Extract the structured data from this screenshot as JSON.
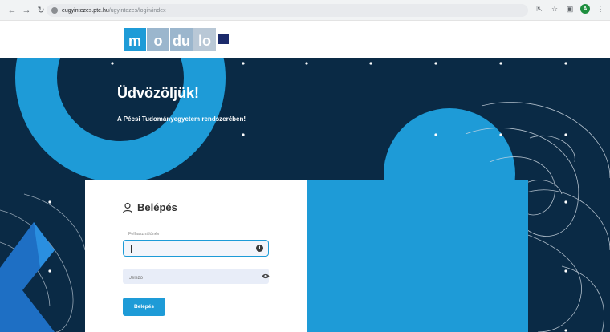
{
  "browser": {
    "url_host": "eugyintezes.pte.hu",
    "url_path": "/ugyintezes/login/index",
    "profile_initial": "A"
  },
  "brand": {
    "logo_letters": [
      "m",
      "o",
      "du",
      "lo"
    ],
    "colors": {
      "primary": "#1e9bd7",
      "navy": "#0a2a45",
      "logo_mark": "#1b2a6b"
    }
  },
  "hero": {
    "title": "Üdvözöljük!",
    "subtitle": "A Pécsi Tudományegyetem rendszerében!"
  },
  "login": {
    "heading": "Belépés",
    "username_label": "Felhasználónév",
    "username_value": "",
    "password_placeholder": "Jelszó",
    "submit_label": "Belépés"
  },
  "icons": {
    "back": "arrow-left-icon",
    "forward": "arrow-right-icon",
    "reload": "reload-icon",
    "lock": "lock-icon",
    "share": "share-icon",
    "bookmark": "star-icon",
    "sidepanel": "side-panel-icon",
    "menu": "kebab-menu-icon",
    "user": "user-icon",
    "info": "info-icon",
    "eye": "eye-icon"
  }
}
